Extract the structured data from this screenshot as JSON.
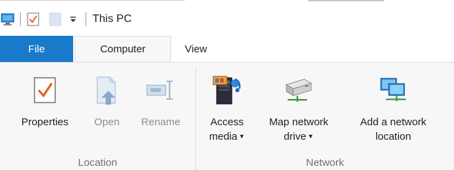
{
  "window": {
    "title": "This PC"
  },
  "tabs": [
    {
      "label": "File"
    },
    {
      "label": "Computer"
    },
    {
      "label": "View"
    }
  ],
  "ribbon": {
    "groups": [
      {
        "label": "Location",
        "buttons": [
          {
            "label": "Properties",
            "icon": "properties-checkmark-icon",
            "enabled": true
          },
          {
            "label": "Open",
            "icon": "open-document-icon",
            "enabled": false
          },
          {
            "label": "Rename",
            "icon": "rename-icon",
            "enabled": false
          }
        ]
      },
      {
        "label": "Network",
        "buttons": [
          {
            "line1": "Access",
            "line2": "media",
            "icon": "access-media-icon",
            "dropdown": true
          },
          {
            "line1": "Map network",
            "line2": "drive",
            "icon": "map-network-drive-icon",
            "dropdown": true
          },
          {
            "line1": "Add a network",
            "line2": "location",
            "icon": "add-network-location-icon",
            "dropdown": false
          }
        ]
      }
    ]
  },
  "colors": {
    "file_tab": "#1979ca",
    "ribbon_bg": "#f7f7f7",
    "accent_orange": "#e8601c",
    "disabled_text": "#8c8c8c"
  }
}
